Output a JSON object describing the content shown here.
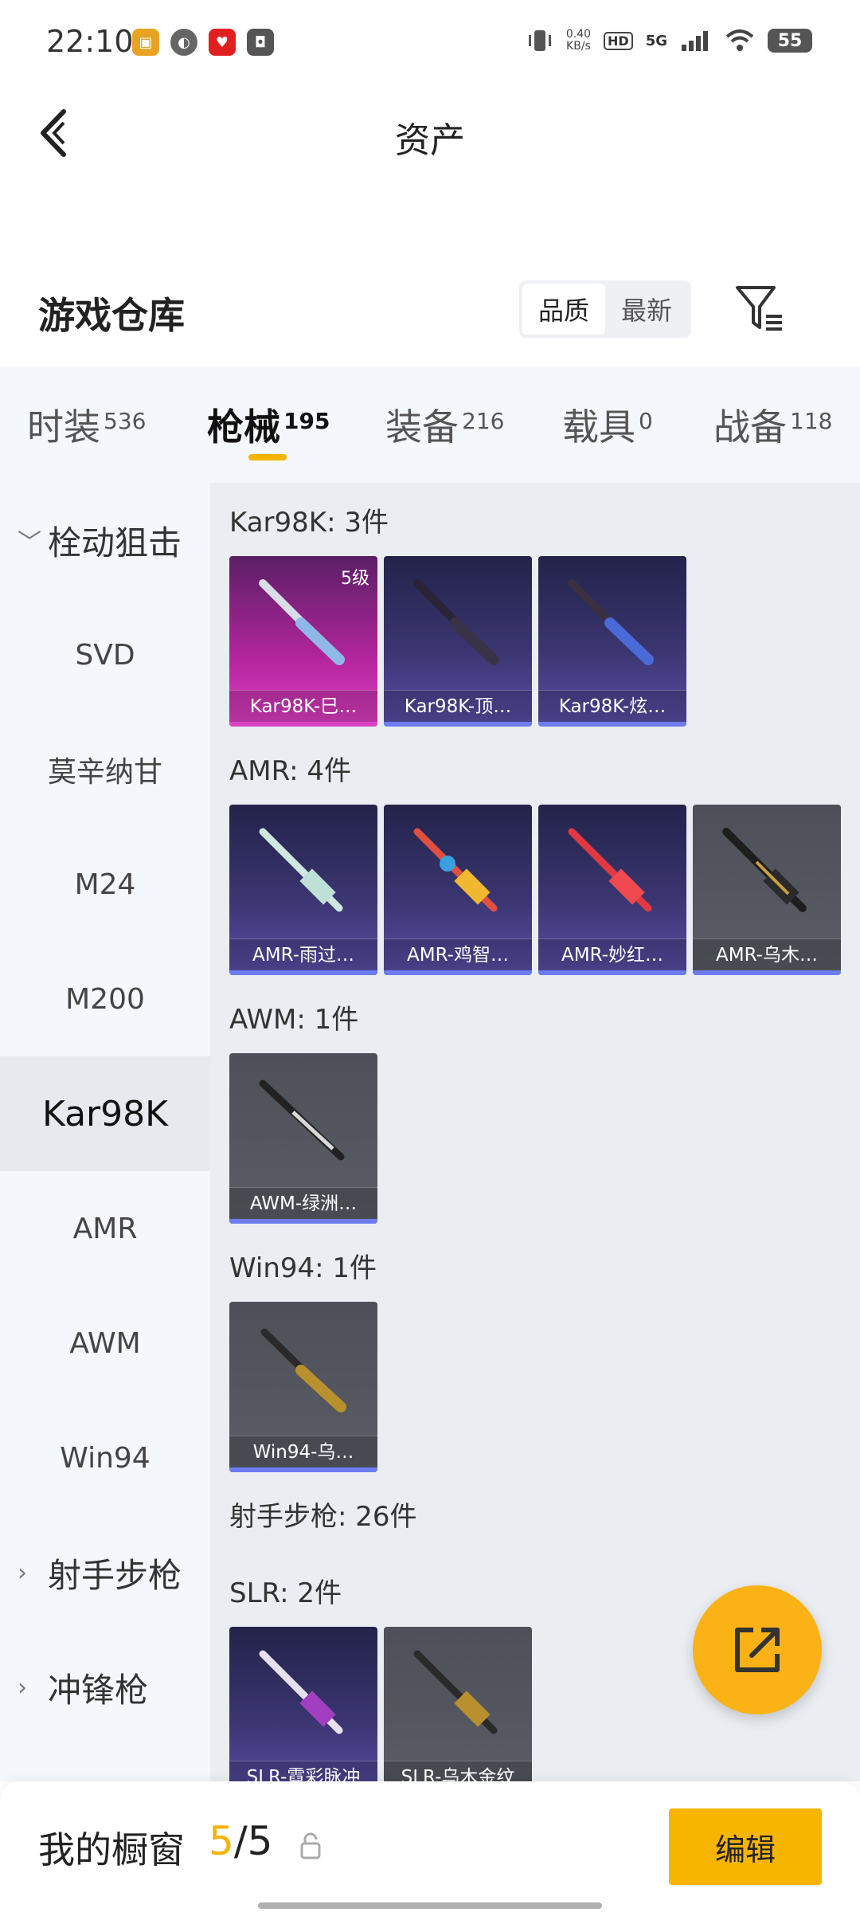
{
  "status_bar": {
    "time": "22:10",
    "speed_value": "0.40",
    "speed_unit": "KB/s",
    "hd": "HD",
    "network": "5G",
    "battery": "55"
  },
  "header": {
    "title": "资产",
    "back_icon": "back-arrow-icon"
  },
  "section": {
    "title": "游戏仓库",
    "sort_options": [
      "品质",
      "最新"
    ],
    "sort_active": "品质",
    "filter_icon": "filter-icon"
  },
  "tabs": [
    {
      "label": "时装",
      "count": "536"
    },
    {
      "label": "枪械",
      "count": "195"
    },
    {
      "label": "装备",
      "count": "216"
    },
    {
      "label": "载具",
      "count": "0"
    },
    {
      "label": "战备",
      "count": "118"
    }
  ],
  "active_tab": "枪械",
  "sidebar": {
    "group_open": "栓动狙击",
    "items": [
      "SVD",
      "莫辛纳甘",
      "M24",
      "M200",
      "Kar98K",
      "AMR",
      "AWM",
      "Win94"
    ],
    "active_item": "Kar98K",
    "groups_closed": [
      "射手步枪",
      "冲锋枪"
    ]
  },
  "content": {
    "groups": [
      {
        "title": "Kar98K: 3件",
        "cards": [
          {
            "label": "Kar98K-巳…",
            "quality": "pink",
            "level": "5级"
          },
          {
            "label": "Kar98K-顶…",
            "quality": "purple"
          },
          {
            "label": "Kar98K-炫…",
            "quality": "purple"
          }
        ]
      },
      {
        "title": "AMR: 4件",
        "cards": [
          {
            "label": "AMR-雨过…",
            "quality": "purple"
          },
          {
            "label": "AMR-鸡智…",
            "quality": "purple"
          },
          {
            "label": "AMR-妙红…",
            "quality": "purple"
          },
          {
            "label": "AMR-乌木…",
            "quality": "gray"
          }
        ]
      },
      {
        "title": "AWM: 1件",
        "cards": [
          {
            "label": "AWM-绿洲…",
            "quality": "gray"
          }
        ]
      },
      {
        "title": "Win94: 1件",
        "cards": [
          {
            "label": "Win94-乌…",
            "quality": "gray"
          }
        ]
      }
    ],
    "category_header": "射手步枪: 26件",
    "slr_group": {
      "title": "SLR: 2件",
      "cards": [
        {
          "label": "SLR-霓彩脉冲",
          "quality": "purple"
        },
        {
          "label": "SLR-乌木金纹",
          "quality": "gray"
        }
      ]
    }
  },
  "fab_icon": "share-icon",
  "bottom_bar": {
    "label": "我的橱窗",
    "current": "5",
    "separator": "/",
    "total": "5",
    "lock_icon": "lock-icon",
    "edit_label": "编辑"
  },
  "colors": {
    "accent": "#f4b400",
    "button": "#f8b500",
    "fab": "#fbb216"
  }
}
